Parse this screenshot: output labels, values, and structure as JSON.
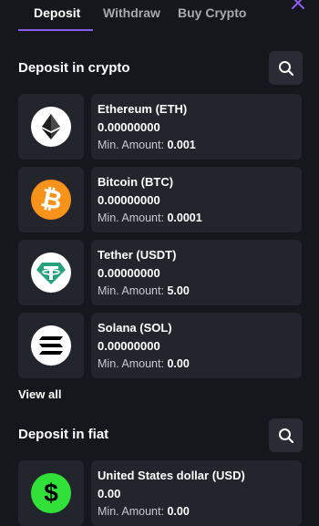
{
  "tabs": [
    "Deposit",
    "Withdraw",
    "Buy Crypto"
  ],
  "colors": {
    "accent": "#8b5cf6",
    "background": "#16171c",
    "card": "#23252d"
  },
  "crypto_section": {
    "title": "Deposit in crypto",
    "items": [
      {
        "name": "Ethereum (ETH)",
        "balance": "0.00000000",
        "min_label": "Min. Amount:",
        "min_value": "0.001",
        "icon": "ethereum-icon"
      },
      {
        "name": "Bitcoin (BTC)",
        "balance": "0.00000000",
        "min_label": "Min. Amount:",
        "min_value": "0.0001",
        "icon": "bitcoin-icon"
      },
      {
        "name": "Tether (USDT)",
        "balance": "0.00000000",
        "min_label": "Min. Amount:",
        "min_value": "5.00",
        "icon": "tether-icon"
      },
      {
        "name": "Solana (SOL)",
        "balance": "0.00000000",
        "min_label": "Min. Amount:",
        "min_value": "0.00",
        "icon": "solana-icon"
      }
    ],
    "view_all": "View all"
  },
  "fiat_section": {
    "title": "Deposit in fiat",
    "items": [
      {
        "name": "United States dollar (USD)",
        "balance": "0.00",
        "min_label": "Min. Amount:",
        "min_value": "0.00",
        "icon": "dollar-icon"
      }
    ]
  }
}
